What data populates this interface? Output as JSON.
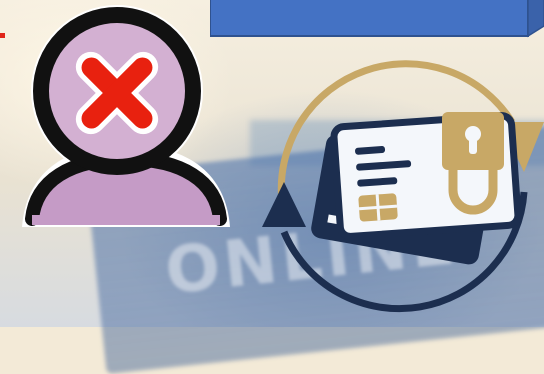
{
  "background": {
    "sign_text": "ONLINE"
  },
  "colors": {
    "banner_blue": "#4472c4",
    "banner_blue_dark": "#2f528f",
    "user_ring": "#111111",
    "user_fill": "#d3b0d2",
    "user_body": "#c59bc6",
    "cross_red": "#e8210f",
    "card_navy": "#1c2e4f",
    "card_light": "#f4f7fb",
    "gold": "#c8a866",
    "arrow_navy": "#1c2e4f"
  },
  "icons": {
    "user": "user-blocked-icon",
    "cross": "red-x-icon",
    "cards": "payment-cards-icon",
    "lock": "padlock-icon",
    "chip": "card-chip-icon",
    "cycle": "refresh-cycle-icon"
  }
}
